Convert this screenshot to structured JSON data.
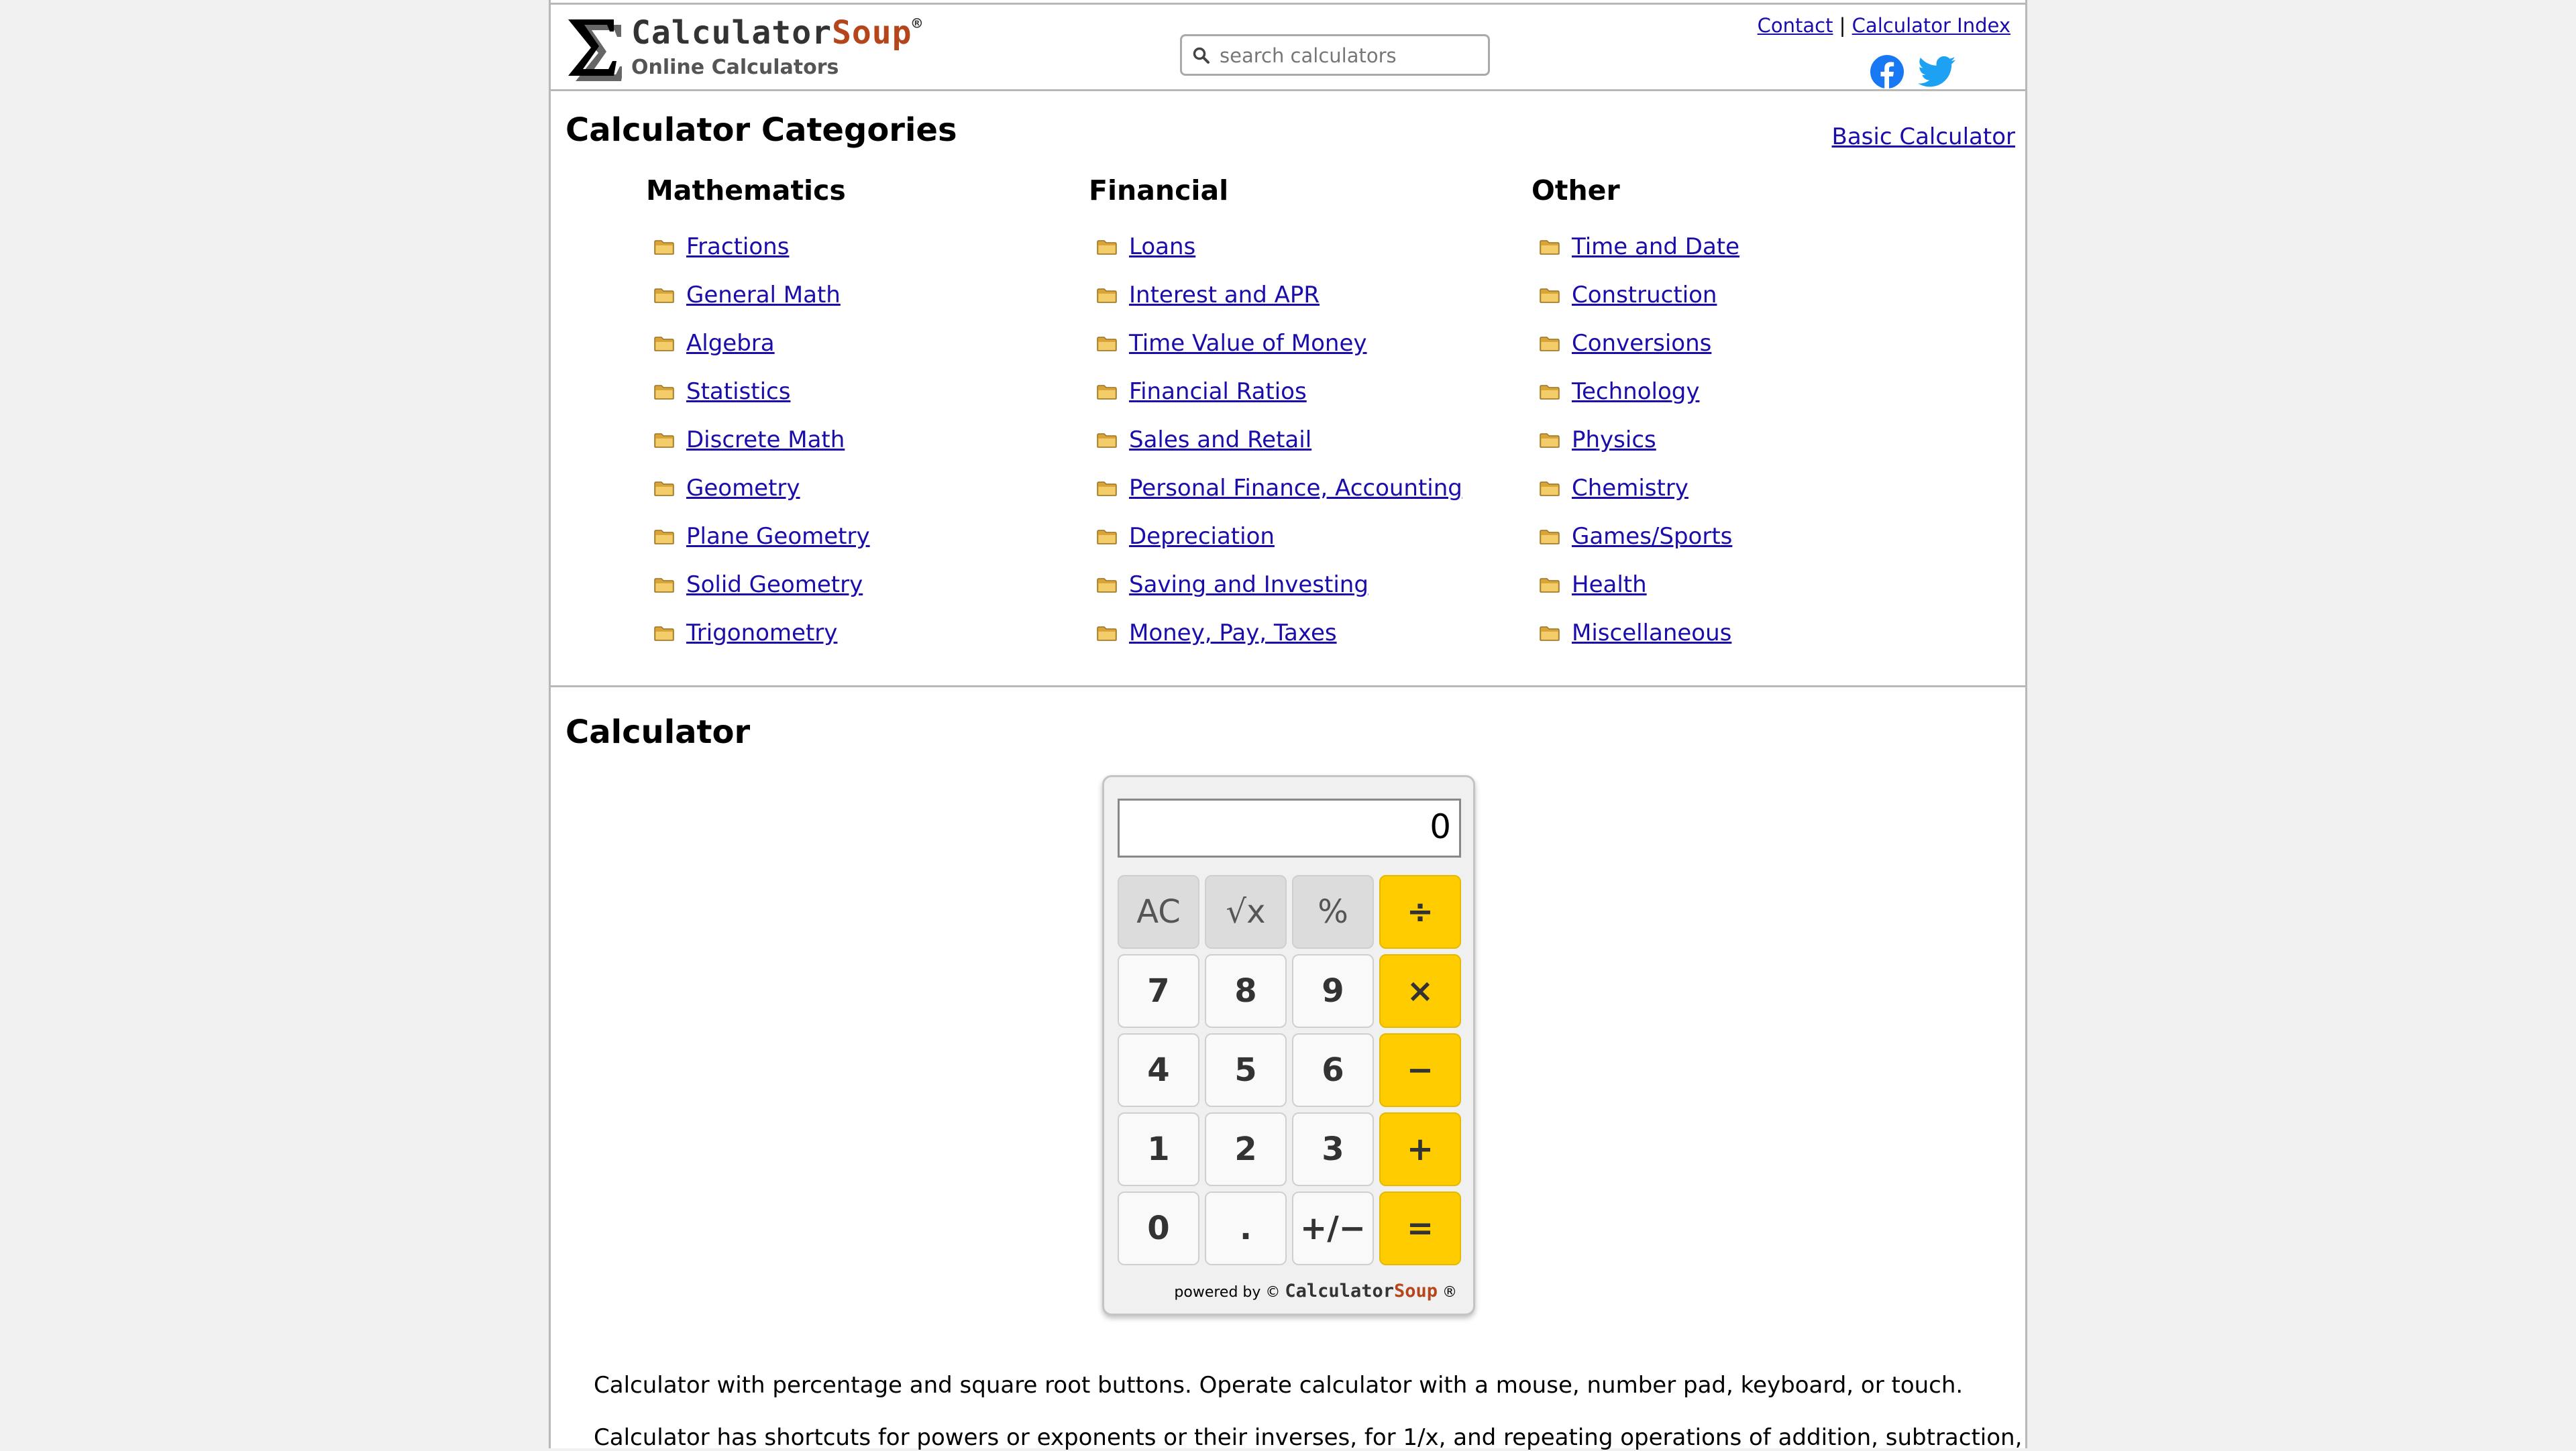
{
  "header": {
    "brand_main": "Calculator",
    "brand_accent": "Soup",
    "brand_reg": "®",
    "subtitle": "Online Calculators",
    "search_placeholder": "search calculators",
    "links": [
      "Contact",
      "Calculator Index"
    ],
    "link_separator": "|"
  },
  "categories": {
    "title": "Calculator Categories",
    "basic_link": "Basic Calculator",
    "columns": [
      {
        "heading": "Mathematics",
        "items": [
          "Fractions",
          "General Math",
          "Algebra",
          "Statistics",
          "Discrete Math",
          "Geometry",
          "Plane Geometry",
          "Solid Geometry",
          "Trigonometry"
        ]
      },
      {
        "heading": "Financial",
        "items": [
          "Loans",
          "Interest and APR",
          "Time Value of Money",
          "Financial Ratios",
          "Sales and Retail",
          "Personal Finance, Accounting",
          "Depreciation",
          "Saving and Investing",
          "Money, Pay, Taxes"
        ]
      },
      {
        "heading": "Other",
        "items": [
          "Time and Date",
          "Construction",
          "Conversions",
          "Technology",
          "Physics",
          "Chemistry",
          "Games/Sports",
          "Health",
          "Miscellaneous"
        ]
      }
    ]
  },
  "calculator": {
    "title": "Calculator",
    "display": "0",
    "keys": [
      [
        "AC",
        "√x",
        "%",
        "÷"
      ],
      [
        "7",
        "8",
        "9",
        "×"
      ],
      [
        "4",
        "5",
        "6",
        "−"
      ],
      [
        "1",
        "2",
        "3",
        "+"
      ],
      [
        "0",
        ".",
        "+/−",
        "="
      ]
    ],
    "powered_prefix": "powered by ©",
    "powered_brand_main": "Calculator",
    "powered_brand_accent": "Soup",
    "powered_suffix": "®"
  },
  "description": [
    "Calculator with percentage and square root buttons. Operate calculator with a mouse, number pad, keyboard, or touch.",
    "Calculator has shortcuts for powers or exponents or their inverses, for 1/x, and repeating operations of addition, subtraction,"
  ],
  "colors": {
    "link": "#1a0dab",
    "operator_key": "#ffcc00",
    "function_key": "#dcdcdc",
    "brand_accent": "#b5451b",
    "facebook": "#1877f2",
    "twitter": "#1da1f2"
  },
  "icons": [
    "sigma-logo-icon",
    "search-icon",
    "facebook-icon",
    "twitter-icon",
    "folder-icon"
  ]
}
